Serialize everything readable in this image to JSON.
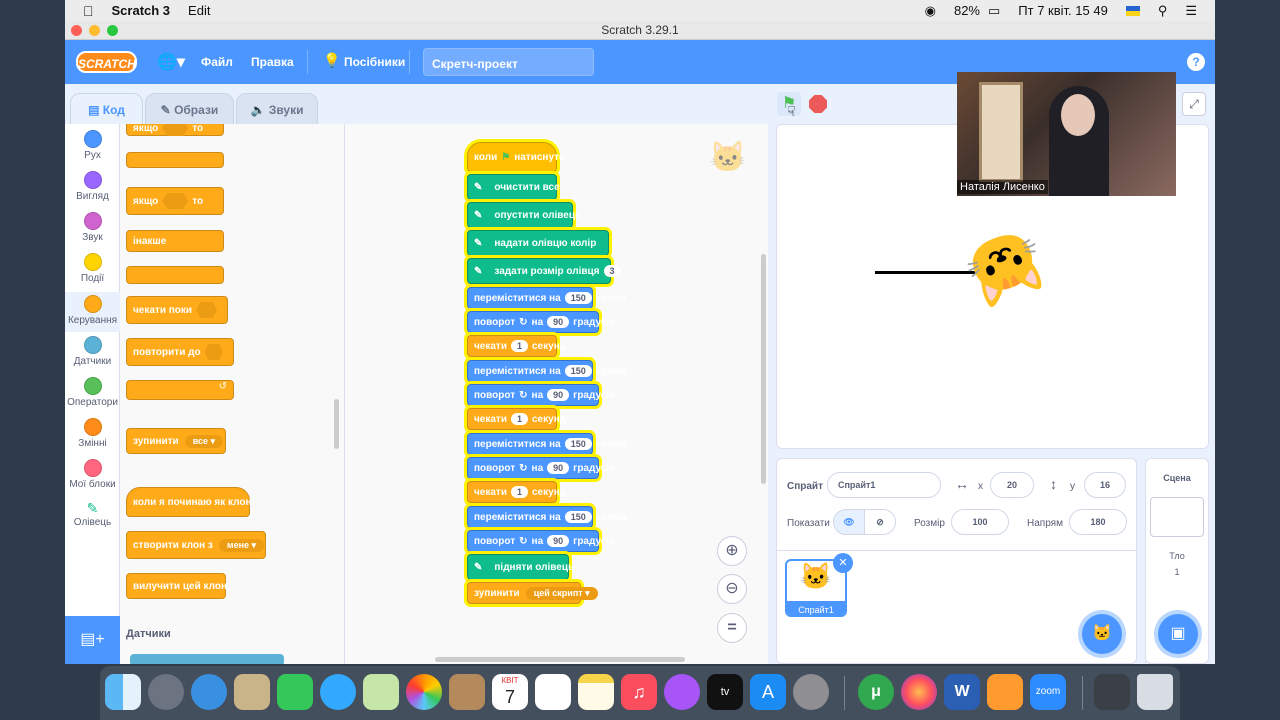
{
  "os": {
    "app": "Scratch 3",
    "menu": "Edit",
    "battery": "82%",
    "datetime": "Пт 7 квіт.  15 49"
  },
  "window": {
    "title": "Scratch 3.29.1"
  },
  "scratch": {
    "logo": "SCRATCH",
    "file": "Файл",
    "edit": "Правка",
    "tutorials": "Посібники",
    "project_title": "Скретч-проект",
    "help": "?"
  },
  "tabs": {
    "code": "Код",
    "costumes": "Образи",
    "sounds": "Звуки"
  },
  "categories": [
    {
      "label": "Рух",
      "color": "#4c97ff"
    },
    {
      "label": "Вигляд",
      "color": "#9966ff"
    },
    {
      "label": "Звук",
      "color": "#cf63cf"
    },
    {
      "label": "Події",
      "color": "#ffd500"
    },
    {
      "label": "Керування",
      "color": "#ffab19"
    },
    {
      "label": "Датчики",
      "color": "#5cb1d6"
    },
    {
      "label": "Оператори",
      "color": "#59c059"
    },
    {
      "label": "Змінні",
      "color": "#ff8c1a"
    },
    {
      "label": "Мої блоки",
      "color": "#ff6680"
    },
    {
      "label": "Олівець",
      "color": "#0fbd8c"
    }
  ],
  "palette": {
    "if": "якщо",
    "then": "то",
    "else": "інакше",
    "wait_until": "чекати поки",
    "repeat_until": "повторити до",
    "stop": "зупинити",
    "stop_opt": "все",
    "clone_start": "коли я починаю як клон",
    "create_clone": "створити клон з",
    "clone_opt": "мене",
    "delete_clone": "вилучити цей клон",
    "sensing": "Датчики"
  },
  "script": {
    "hat": "коли",
    "hat2": "натиснуто",
    "pen": [
      {
        "t": "очистити все"
      },
      {
        "t": "опустити олівець"
      },
      {
        "t": "надати олівцю колір"
      },
      {
        "t": "задати розмір олівця",
        "v": "3"
      }
    ],
    "move": "переміститися на",
    "steps_unit": "кроків",
    "turn": "поворот",
    "turn_on": "на",
    "deg": "градусів",
    "wait": "чекати",
    "sec": "секунд",
    "steps": "150",
    "angle": "90",
    "waitv": "1",
    "penup": "підняти олівець",
    "stop": "зупинити",
    "stop_opt": "цей скрипт"
  },
  "zoom": {
    "reset": "="
  },
  "sprite": {
    "label": "Спрайт",
    "name": "Спрайт1",
    "x_label": "x",
    "x": "20",
    "y_label": "y",
    "y": "16",
    "show": "Показати",
    "size_label": "Розмір",
    "size": "100",
    "dir_label": "Напрям",
    "dir": "180",
    "thumb": "Спрайт1"
  },
  "scene": {
    "title": "Сцена",
    "bg": "Тло",
    "count": "1"
  },
  "webcam": {
    "name": "Наталія Лисенко"
  },
  "dock": {
    "calendar_month": "КВІТ",
    "calendar_day": "7",
    "zoom": "zoom"
  }
}
